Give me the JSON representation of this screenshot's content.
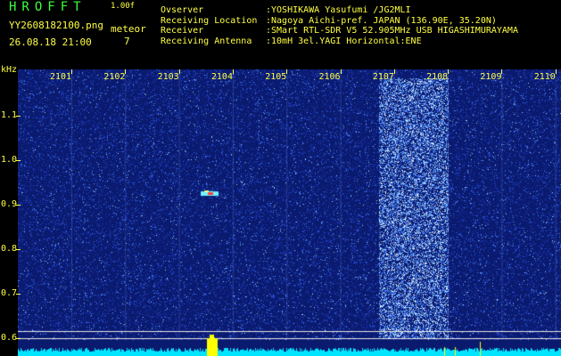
{
  "header": {
    "app_name": "HROFFT",
    "app_version": "1.00f",
    "file_name": "YY2608182100.png",
    "meteor_label": "meteor",
    "date_time": "26.08.18 21:00",
    "meteor_count": "7"
  },
  "info": [
    {
      "label": "Ovserver",
      "value": ":YOSHIKAWA Yasufumi /JG2MLI"
    },
    {
      "label": "Receiving Location",
      "value": ":Nagoya Aichi-pref. JAPAN (136.90E, 35.20N)"
    },
    {
      "label": "Receiver",
      "value": ":SMart RTL-SDR V5 52.905MHz USB HIGASHIMURAYAMA"
    },
    {
      "label": "Receiving Antenna",
      "value": ":10mH 3el.YAGI Horizontal:ENE"
    }
  ],
  "axes": {
    "y_unit": "kHz",
    "y_ticks": [
      "1.1",
      "1.0",
      "0.9",
      "0.8",
      "0.7",
      "0.6"
    ],
    "y_values": [
      1.1,
      1.0,
      0.9,
      0.8,
      0.7,
      0.6
    ],
    "x_ticks": [
      "2101",
      "2102",
      "2103",
      "2104",
      "2105",
      "2106",
      "2107",
      "2108",
      "2109",
      "2110"
    ]
  },
  "colors": {
    "text_green": "#3cff3c",
    "text_yellow": "#ffff44",
    "noise_floor": "#00e5ff",
    "background_blue": "#0a1a6e"
  }
}
